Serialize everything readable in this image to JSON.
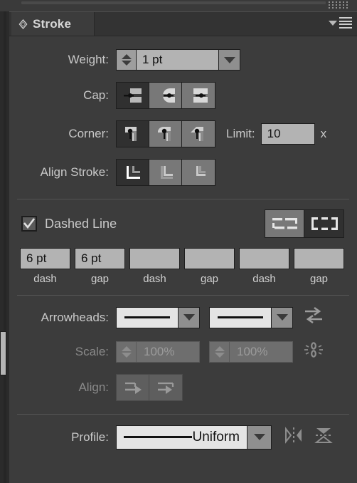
{
  "window": {
    "grip_icon": "grip-dots-icon"
  },
  "panel": {
    "tab_label": "Stroke",
    "tab_icon": "diamond-icon",
    "menu_icon": "panel-menu-icon",
    "collapse_icon": "chevron-down-icon"
  },
  "weight": {
    "label": "Weight:",
    "value": "1 pt",
    "stepper_icon": "stepper-icon",
    "dropdown_icon": "chevron-down-icon"
  },
  "cap": {
    "label": "Cap:",
    "options": [
      {
        "name": "butt-cap",
        "selected": true
      },
      {
        "name": "round-cap",
        "selected": false
      },
      {
        "name": "projecting-cap",
        "selected": false
      }
    ]
  },
  "corner": {
    "label": "Corner:",
    "options": [
      {
        "name": "miter-join",
        "selected": true
      },
      {
        "name": "round-join",
        "selected": false
      },
      {
        "name": "bevel-join",
        "selected": false
      }
    ],
    "limit_label": "Limit:",
    "limit_value": "10",
    "limit_unit": "x"
  },
  "align_stroke": {
    "label": "Align Stroke:",
    "options": [
      {
        "name": "align-stroke-center",
        "selected": true
      },
      {
        "name": "align-stroke-inside",
        "selected": false
      },
      {
        "name": "align-stroke-outside",
        "selected": false
      }
    ]
  },
  "dashed_line": {
    "label": "Dashed Line",
    "checked": true,
    "check_icon": "checkmark-icon",
    "dash_align_options": [
      {
        "name": "preserve-exact-dash-gap-lengths",
        "selected": false
      },
      {
        "name": "align-dashes-to-corners",
        "selected": true
      }
    ],
    "fields": [
      {
        "value": "6 pt",
        "caption": "dash"
      },
      {
        "value": "6 pt",
        "caption": "gap"
      },
      {
        "value": "",
        "caption": "dash"
      },
      {
        "value": "",
        "caption": "gap"
      },
      {
        "value": "",
        "caption": "dash"
      },
      {
        "value": "",
        "caption": "gap"
      }
    ]
  },
  "arrowheads": {
    "label": "Arrowheads:",
    "start_value": "none-line",
    "end_value": "none-line",
    "dropdown_icon": "chevron-down-icon",
    "swap_icon": "swap-arrowheads-icon"
  },
  "scale": {
    "label": "Scale:",
    "start_value": "100%",
    "end_value": "100%",
    "enabled": false,
    "link_icon": "link-broken-icon"
  },
  "arrow_align": {
    "label": "Align:",
    "enabled": false,
    "options": [
      {
        "name": "extend-arrow-tip-beyond-path-end",
        "selected": false
      },
      {
        "name": "place-arrow-tip-at-path-end",
        "selected": false
      }
    ]
  },
  "profile": {
    "label": "Profile:",
    "value": "Uniform",
    "dropdown_icon": "chevron-down-icon",
    "flip_along_icon": "flip-along-icon",
    "flip_across_icon": "flip-across-icon"
  },
  "colors": {
    "panel_bg": "#3c3c3c",
    "tabbar_bg": "#333333",
    "label_text": "#c9c9c9",
    "disabled_text": "#8a8a8a",
    "field_bg": "#b3b3b3",
    "button_bg": "#787878",
    "button_selected_bg": "#303030"
  }
}
